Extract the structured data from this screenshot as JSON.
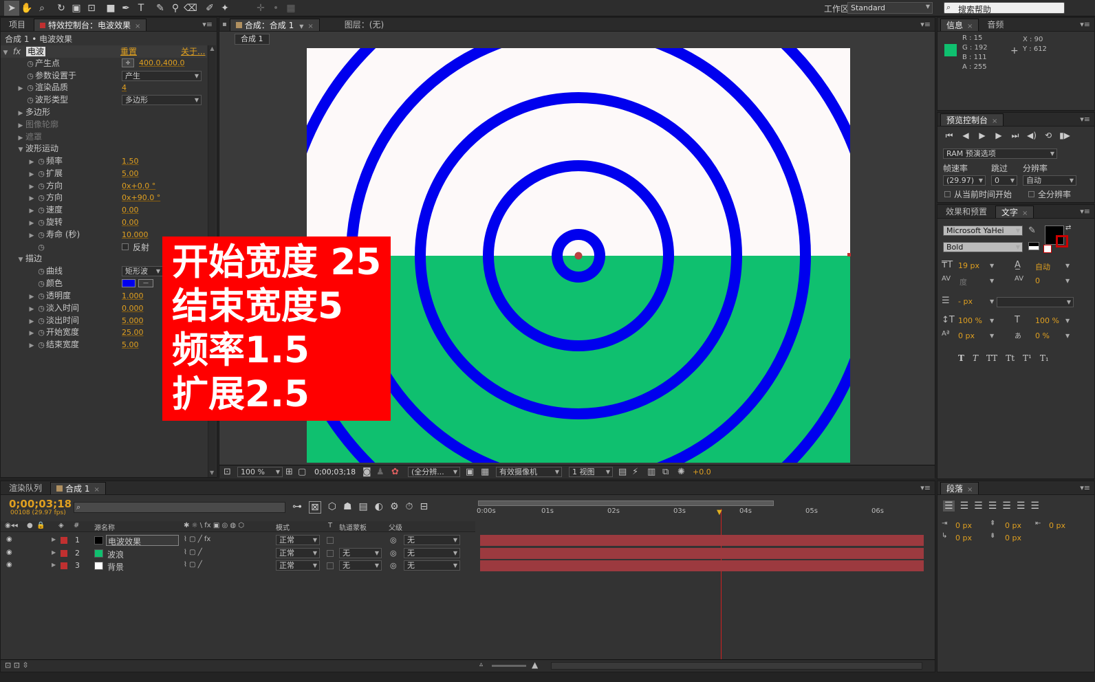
{
  "toolbar": {
    "workspace_label": "工作区：",
    "workspace_value": "Standard",
    "search_placeholder": "搜索帮助"
  },
  "effects_panel": {
    "tab_project": "项目",
    "tab_effects": "特效控制台：电波效果",
    "breadcrumb": "合成 1 • 电波效果",
    "effect_name": "电波",
    "reset": "重置",
    "about": "关于...",
    "props": [
      {
        "name": "产生点",
        "value": "400.0,400.0"
      },
      {
        "name": "参数设置于",
        "value": "产生"
      },
      {
        "name": "渲染品质",
        "value": "4"
      },
      {
        "name": "波形类型",
        "value": "多边形"
      },
      {
        "name": "多边形",
        "value": ""
      },
      {
        "name": "图像轮廓",
        "value": ""
      },
      {
        "name": "遮罩",
        "value": ""
      },
      {
        "name": "波形运动",
        "value": ""
      },
      {
        "name": "频率",
        "value": "1.50"
      },
      {
        "name": "扩展",
        "value": "5.00"
      },
      {
        "name": "方向",
        "value": "0x+0.0 °"
      },
      {
        "name": "方向",
        "value": "0x+90.0 °"
      },
      {
        "name": "速度",
        "value": "0.00"
      },
      {
        "name": "旋转",
        "value": "0.00"
      },
      {
        "name": "寿命 (秒)",
        "value": "10.000"
      },
      {
        "name": "",
        "value": "反射"
      },
      {
        "name": "描边",
        "value": ""
      },
      {
        "name": "曲线",
        "value": "矩形波"
      },
      {
        "name": "颜色",
        "value": ""
      },
      {
        "name": "透明度",
        "value": "1.000"
      },
      {
        "name": "淡入时间",
        "value": "0.000"
      },
      {
        "name": "淡出时间",
        "value": "5.000"
      },
      {
        "name": "开始宽度",
        "value": "25.00"
      },
      {
        "name": "结束宽度",
        "value": "5.00"
      }
    ]
  },
  "overlay": {
    "line1": "开始宽度 25",
    "line2": "结束宽度5",
    "line3": "频率1.5",
    "line4": "扩展2.5"
  },
  "comp_panel": {
    "tab_comp": "合成：合成 1",
    "tab_layer": "图层：(无)",
    "subtab": "合成 1",
    "zoom": "100 %",
    "timecode": "0;00;03;18",
    "resolution": "(全分辨...",
    "camera": "有效摄像机",
    "views": "1 视图",
    "exposure": "+0.0"
  },
  "info_panel": {
    "tab_info": "信息",
    "tab_audio": "音频",
    "r": "R : 15",
    "g": "G : 192",
    "b": "B : 111",
    "a": "A : 255",
    "x": "X : 90",
    "y": "Y : 612",
    "swatch": "#0fc06f"
  },
  "preview_panel": {
    "tab": "预览控制台",
    "ram": "RAM 预演选项",
    "fps_label": "帧速率",
    "skip_label": "跳过",
    "res_label": "分辨率",
    "fps_value": "(29.97)",
    "skip_value": "0",
    "res_value": "自动",
    "from_current": "从当前时间开始",
    "full_screen": "全分辨率"
  },
  "char_panel": {
    "tab_effects": "效果和预置",
    "tab_text": "文字",
    "font": "Microsoft YaHei",
    "style": "Bold",
    "size": "19 px",
    "leading": "自动",
    "kerning": "度",
    "tracking": "0",
    "stroke": "- px",
    "vscale": "100 %",
    "hscale": "100 %",
    "baseline": "0 px",
    "tsume": "0 %",
    "styles": [
      "T",
      "T",
      "TT",
      "Tt",
      "T¹",
      "T₁"
    ]
  },
  "para_panel": {
    "tab": "段落",
    "values": [
      "0 px",
      "0 px",
      "0 px",
      "0 px",
      "0 px"
    ]
  },
  "timeline": {
    "tab_render": "渲染队列",
    "tab_comp": "合成 1",
    "timecode": "0;00;03;18",
    "frame_info": "00108 (29.97 fps)",
    "col_num": "#",
    "col_source": "源名称",
    "col_mode": "模式",
    "col_t": "T",
    "col_trkmat": "轨道蒙板",
    "col_parent": "父级",
    "ticks": [
      "0:00s",
      "01s",
      "02s",
      "03s",
      "04s",
      "05s",
      "06s"
    ],
    "layers": [
      {
        "num": "1",
        "name": "电波效果",
        "mode": "正常",
        "trkmat": "",
        "parent": "无",
        "swatch": "#000000",
        "label": "#c03030"
      },
      {
        "num": "2",
        "name": "波浪",
        "mode": "正常",
        "trkmat": "无",
        "parent": "无",
        "swatch": "#0fc06f",
        "label": "#c03030"
      },
      {
        "num": "3",
        "name": "背景",
        "mode": "正常",
        "trkmat": "无",
        "parent": "无",
        "swatch": "#ffffff",
        "label": "#c03030"
      }
    ],
    "playhead_fraction": 0.543
  },
  "colors": {
    "accent": "#e0a020",
    "ring": "#0000ee",
    "green": "#0fc06f",
    "overlay_bg": "#ff0000"
  }
}
